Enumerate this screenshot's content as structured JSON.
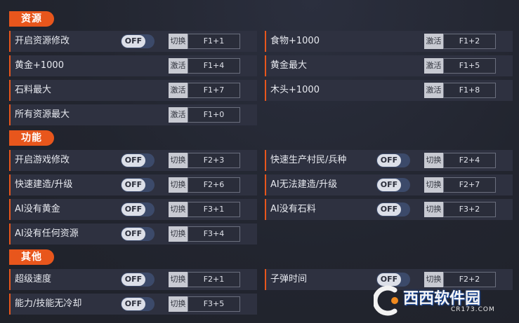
{
  "sections": {
    "resources": {
      "title": "资源",
      "rows": [
        {
          "label": "开启资源修改",
          "toggle": "OFF",
          "action": "切换",
          "key": "F1+1"
        },
        {
          "label": "食物+1000",
          "action": "激活",
          "key": "F1+2"
        },
        {
          "label": "黄金+1000",
          "action": "激活",
          "key": "F1+4"
        },
        {
          "label": "黄金最大",
          "action": "激活",
          "key": "F1+5"
        },
        {
          "label": "石料最大",
          "action": "激活",
          "key": "F1+7"
        },
        {
          "label": "木头+1000",
          "action": "激活",
          "key": "F1+8"
        },
        {
          "label": "所有资源最大",
          "action": "激活",
          "key": "F1+0"
        }
      ]
    },
    "features": {
      "title": "功能",
      "rows": [
        {
          "label": "开启游戏修改",
          "toggle": "OFF",
          "action": "切换",
          "key": "F2+3"
        },
        {
          "label": "快速生产村民/兵种",
          "toggle": "OFF",
          "action": "切换",
          "key": "F2+4"
        },
        {
          "label": "快速建造/升级",
          "toggle": "OFF",
          "action": "切换",
          "key": "F2+6"
        },
        {
          "label": "AI无法建造/升级",
          "toggle": "OFF",
          "action": "切换",
          "key": "F2+7"
        },
        {
          "label": "AI没有黄金",
          "toggle": "OFF",
          "action": "切换",
          "key": "F3+1"
        },
        {
          "label": "AI没有石料",
          "toggle": "OFF",
          "action": "切换",
          "key": "F3+2"
        },
        {
          "label": "AI没有任何资源",
          "toggle": "OFF",
          "action": "切换",
          "key": "F3+4"
        }
      ]
    },
    "other": {
      "title": "其他",
      "rows": [
        {
          "label": "超级速度",
          "toggle": "OFF",
          "action": "切换",
          "key": "F2+1"
        },
        {
          "label": "子弹时间",
          "toggle": "OFF",
          "action": "切换",
          "key": "F2+2"
        },
        {
          "label": "能力/技能无冷却",
          "toggle": "OFF",
          "action": "切换",
          "key": "F3+5"
        }
      ]
    }
  },
  "watermark": {
    "text": "西西软件园",
    "sub": "CR173.COM"
  },
  "colors": {
    "accent": "#e8561c",
    "row_bg": "#2e3140",
    "toggle_bg": "#3c4a6a"
  }
}
